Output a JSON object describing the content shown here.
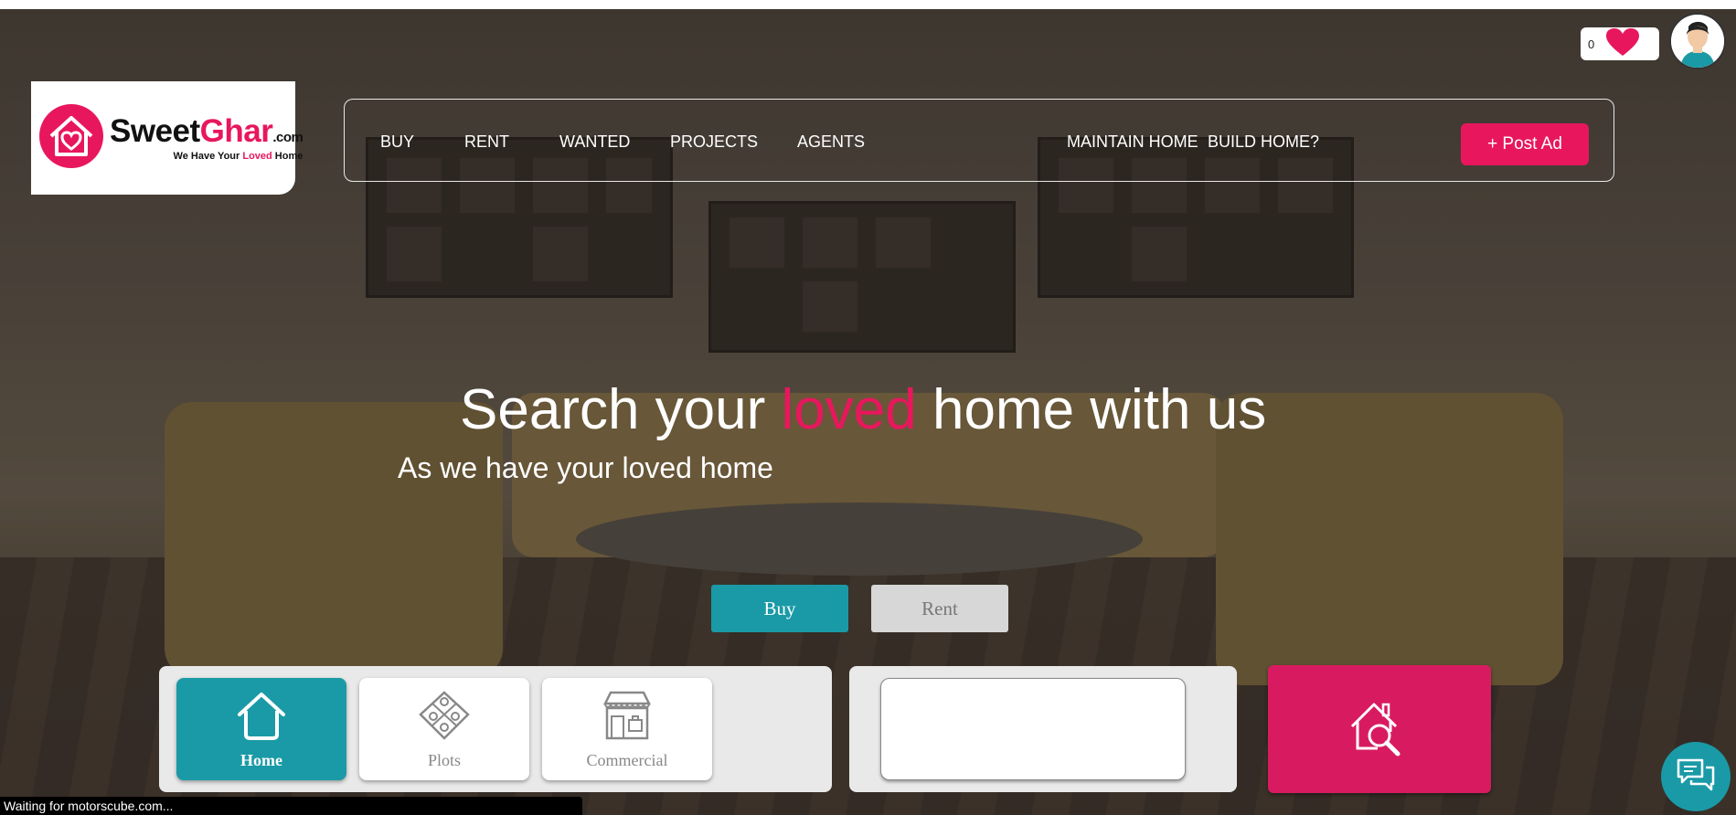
{
  "header": {
    "wishlist_count": "0",
    "logo": {
      "brand_part1": "Sweet",
      "brand_part2": "Ghar",
      "brand_suffix": ".com",
      "tagline_before": "We Have Your ",
      "tagline_accent": "Loved",
      "tagline_after": " Home"
    }
  },
  "nav": {
    "items": [
      "BUY",
      "RENT",
      "WANTED",
      "PROJECTS",
      "AGENTS",
      "MAINTAIN HOME",
      "BUILD HOME?"
    ],
    "post_ad_label": "+ Post Ad"
  },
  "hero": {
    "headline_before": "Search your ",
    "headline_accent": "loved",
    "headline_after": " home with us",
    "subheadline": "As we have your loved home"
  },
  "search": {
    "tabs": [
      {
        "label": "Buy",
        "active": true
      },
      {
        "label": "Rent",
        "active": false
      }
    ],
    "property_types": [
      {
        "label": "Home",
        "icon": "home-icon",
        "active": true
      },
      {
        "label": "Plots",
        "icon": "plots-icon",
        "active": false
      },
      {
        "label": "Commercial",
        "icon": "commercial-icon",
        "active": false
      }
    ],
    "location_value": "",
    "search_button_icon": "house-search-icon"
  },
  "chat": {
    "icon": "chat-icon"
  },
  "status_bar": {
    "text": "Waiting for motorscube.com..."
  },
  "colors": {
    "brand_pink": "#e8175d",
    "teal": "#1a9aa6",
    "search_pink": "#d81b60"
  }
}
